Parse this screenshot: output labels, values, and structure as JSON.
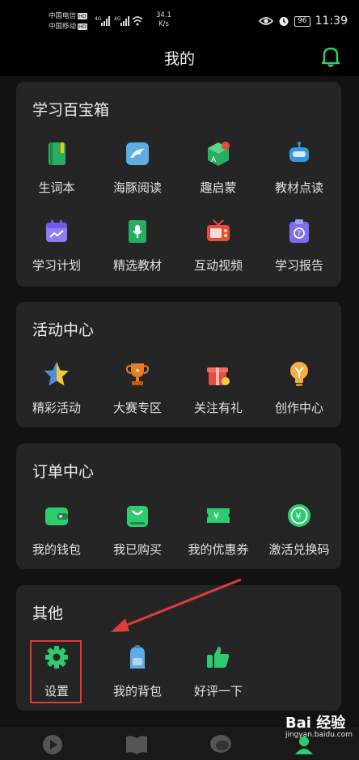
{
  "status_bar": {
    "carrier1": "中国电信",
    "carrier2": "中国移动",
    "hd": "HD",
    "net": "4G",
    "speed_value": "34.1",
    "speed_unit": "K/s",
    "battery": "96",
    "time": "11:39"
  },
  "header": {
    "title": "我的"
  },
  "sections": {
    "toolbox": {
      "title": "学习百宝箱",
      "items": [
        {
          "label": "生词本",
          "icon": "notebook-icon"
        },
        {
          "label": "海豚阅读",
          "icon": "dolphin-icon"
        },
        {
          "label": "趣启蒙",
          "icon": "abc-cube-icon"
        },
        {
          "label": "教材点读",
          "icon": "robot-icon"
        },
        {
          "label": "学习计划",
          "icon": "calendar-icon"
        },
        {
          "label": "精选教材",
          "icon": "book-mic-icon"
        },
        {
          "label": "互动视频",
          "icon": "tv-icon"
        },
        {
          "label": "学习报告",
          "icon": "report-icon"
        }
      ]
    },
    "activities": {
      "title": "活动中心",
      "items": [
        {
          "label": "精彩活动",
          "icon": "star-icon"
        },
        {
          "label": "大赛专区",
          "icon": "trophy-icon"
        },
        {
          "label": "关注有礼",
          "icon": "gift-icon"
        },
        {
          "label": "创作中心",
          "icon": "bulb-icon"
        }
      ]
    },
    "orders": {
      "title": "订单中心",
      "items": [
        {
          "label": "我的钱包",
          "icon": "wallet-icon"
        },
        {
          "label": "我已购买",
          "icon": "shopping-bag-icon"
        },
        {
          "label": "我的优惠券",
          "icon": "coupon-icon"
        },
        {
          "label": "激活兑换码",
          "icon": "exchange-icon"
        }
      ]
    },
    "others": {
      "title": "其他",
      "items": [
        {
          "label": "设置",
          "icon": "gear-icon"
        },
        {
          "label": "我的背包",
          "icon": "backpack-icon"
        },
        {
          "label": "好评一下",
          "icon": "thumbs-up-icon"
        }
      ]
    }
  },
  "bottom_nav": {
    "items": [
      {
        "icon": "play-icon"
      },
      {
        "icon": "book-icon"
      },
      {
        "icon": "chat-icon"
      },
      {
        "icon": "profile-icon"
      }
    ]
  },
  "watermark": {
    "brand": "Bai 经验",
    "url": "jingyan.baidu.com"
  },
  "colors": {
    "background": "#121212",
    "card": "#252525",
    "accent_green": "#2ecc71",
    "highlight_red": "#e23b3b"
  }
}
